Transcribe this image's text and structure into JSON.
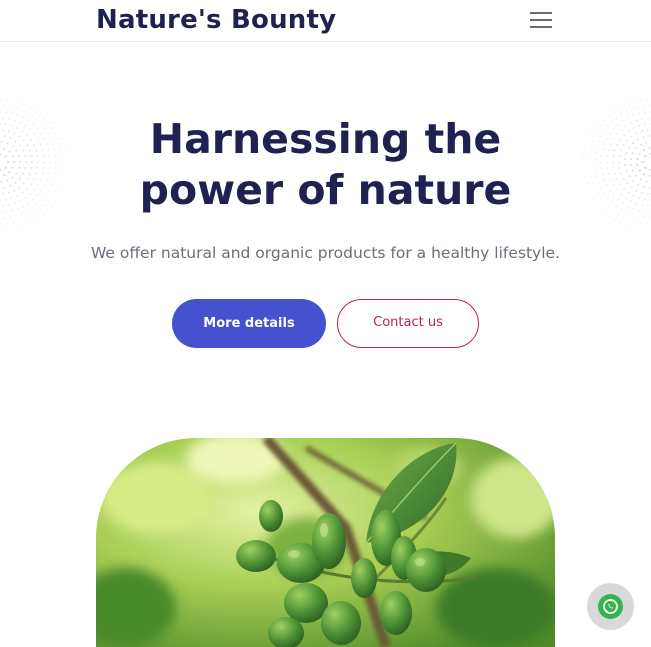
{
  "header": {
    "brand": "Nature's Bounty",
    "menu_icon": "hamburger-menu-icon"
  },
  "hero": {
    "title_line1": "Harnessing the",
    "title_line2": "power of nature",
    "subtitle": "We offer natural and organic products for a healthy lifestyle.",
    "primary_button": "More details",
    "secondary_button": "Contact us",
    "image_subject": "green-berries-on-branch"
  },
  "floating": {
    "icon": "whatsapp-icon"
  },
  "colors": {
    "brand_text": "#1f2150",
    "primary_button": "#4551cf",
    "secondary_button_border": "#b5245a",
    "subtitle_text": "#6a6f79",
    "whatsapp_green": "#34b34f"
  }
}
